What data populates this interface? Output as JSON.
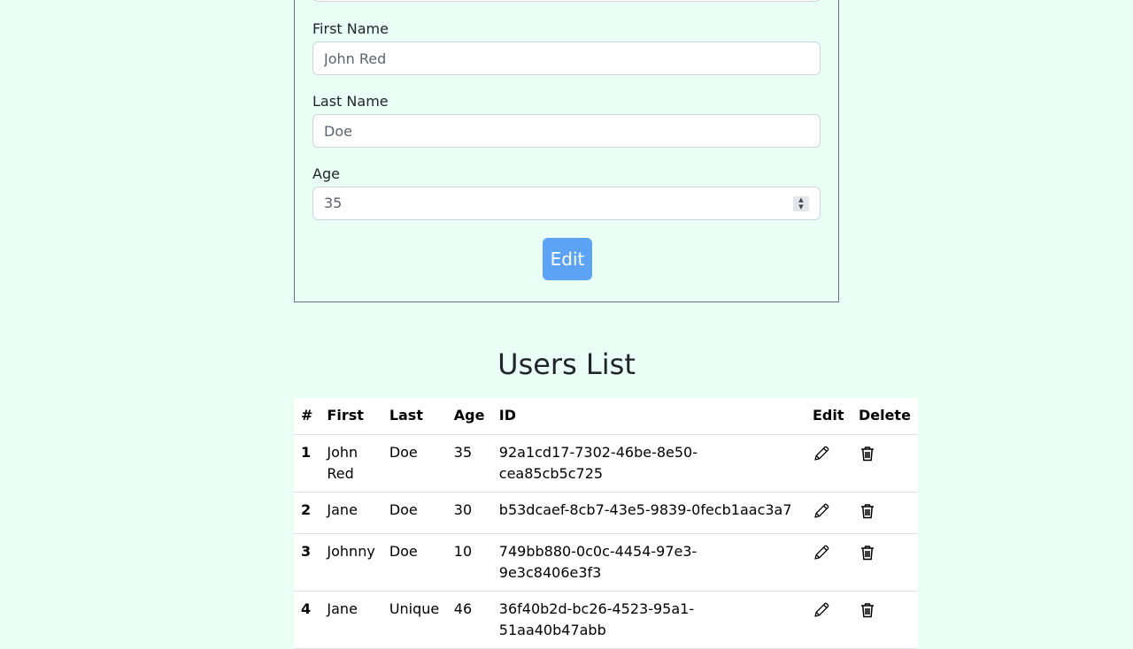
{
  "form": {
    "first_name_label": "First Name",
    "first_name_value": "John Red",
    "last_name_label": "Last Name",
    "last_name_value": "Doe",
    "age_label": "Age",
    "age_value": "35",
    "submit_label": "Edit"
  },
  "users": {
    "title": "Users List",
    "columns": [
      "#",
      "First",
      "Last",
      "Age",
      "ID",
      "Edit",
      "Delete"
    ],
    "rows": [
      {
        "num": "1",
        "first": "John Red",
        "last": "Doe",
        "age": "35",
        "id": "92a1cd17-7302-46be-8e50-cea85cb5c725"
      },
      {
        "num": "2",
        "first": "Jane",
        "last": "Doe",
        "age": "30",
        "id": "b53dcaef-8cb7-43e5-9839-0fecb1aac3a7"
      },
      {
        "num": "3",
        "first": "Johnny",
        "last": "Doe",
        "age": "10",
        "id": "749bb880-0c0c-4454-97e3-9e3c8406e3f3"
      },
      {
        "num": "4",
        "first": "Jane",
        "last": "Unique",
        "age": "46",
        "id": "36f40b2d-bc26-4523-95a1-51aa40b47abb"
      }
    ],
    "edit_icon": "pencil-icon",
    "delete_icon": "trash-icon"
  }
}
